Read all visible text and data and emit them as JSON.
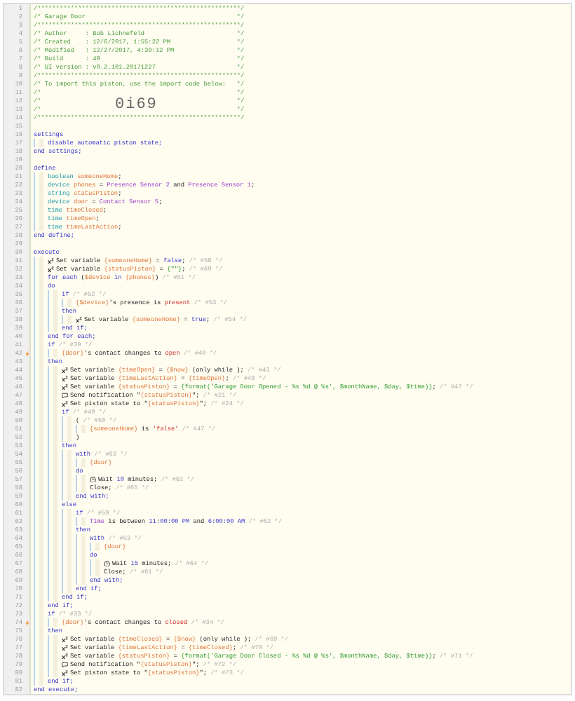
{
  "lines": [
    {
      "n": "1",
      "banner": true,
      "tokens": [
        {
          "t": "/*******************************************************/",
          "kind": "hdr"
        }
      ]
    },
    {
      "n": "2",
      "banner": true,
      "tokens": [
        {
          "t": "/* Garage Door",
          "kind": "hdr"
        },
        {
          "t": "*/",
          "kind": "hdr"
        }
      ]
    },
    {
      "n": "3",
      "banner": true,
      "tokens": [
        {
          "t": "/*******************************************************/",
          "kind": "hdr"
        }
      ]
    },
    {
      "n": "4",
      "banner": true,
      "tokens": [
        {
          "t": "/* Author     : Bob Lichnefeld",
          "kind": "hdr"
        },
        {
          "t": "*/",
          "kind": "hdr"
        }
      ]
    },
    {
      "n": "5",
      "banner": true,
      "tokens": [
        {
          "t": "/* Created    : 12/6/2017, 1:55:22 PM",
          "kind": "hdr"
        },
        {
          "t": "*/",
          "kind": "hdr"
        }
      ]
    },
    {
      "n": "6",
      "banner": true,
      "tokens": [
        {
          "t": "/* Modified   : 12/27/2017, 4:39:12 PM",
          "kind": "hdr"
        },
        {
          "t": "*/",
          "kind": "hdr"
        }
      ]
    },
    {
      "n": "7",
      "banner": true,
      "tokens": [
        {
          "t": "/* Build      : 49",
          "kind": "hdr"
        },
        {
          "t": "*/",
          "kind": "hdr"
        }
      ]
    },
    {
      "n": "8",
      "banner": true,
      "tokens": [
        {
          "t": "/* UI version : v0.2.101.20171227",
          "kind": "hdr"
        },
        {
          "t": "*/",
          "kind": "hdr"
        }
      ]
    },
    {
      "n": "9",
      "banner": true,
      "tokens": [
        {
          "t": "/*******************************************************/",
          "kind": "hdr"
        }
      ]
    },
    {
      "n": "10",
      "banner": true,
      "tokens": [
        {
          "t": "/* To import this piston, use the import code below:",
          "kind": "hdr"
        },
        {
          "t": "*/",
          "kind": "hdr"
        }
      ]
    },
    {
      "n": "11",
      "banner": true,
      "tokens": [
        {
          "t": "/*",
          "kind": "hdr"
        },
        {
          "t": "*/",
          "kind": "hdr"
        }
      ]
    },
    {
      "n": "12",
      "banner": true,
      "import_code": "0i69",
      "tokens": [
        {
          "t": "/*",
          "kind": "hdr"
        },
        {
          "t": "*/",
          "kind": "hdr"
        }
      ]
    },
    {
      "n": "13",
      "banner": true,
      "tokens": [
        {
          "t": "/*",
          "kind": "hdr"
        },
        {
          "t": "*/",
          "kind": "hdr"
        }
      ]
    },
    {
      "n": "14",
      "banner": true,
      "tokens": [
        {
          "t": "/*******************************************************/",
          "kind": "hdr"
        }
      ]
    },
    {
      "n": "15"
    },
    {
      "n": "16",
      "tokens": [
        {
          "t": "settings",
          "kind": "kw"
        }
      ],
      "children": [
        {
          "n": "17",
          "tokens": [
            {
              "t": "disable automatic piston state;",
              "kind": "kw"
            }
          ]
        }
      ]
    },
    {
      "n": "18",
      "tokens": [
        {
          "t": "end settings;",
          "kind": "kw"
        }
      ]
    },
    {
      "n": "19"
    },
    {
      "n": "20",
      "tokens": [
        {
          "t": "define",
          "kind": "kw"
        }
      ],
      "children": [
        {
          "n": "21",
          "tokens": [
            {
              "t": "boolean ",
              "kind": "type"
            },
            {
              "t": "someoneHome",
              "kind": "var"
            },
            {
              "t": ";",
              "kind": "txt"
            }
          ]
        },
        {
          "n": "22",
          "tokens": [
            {
              "t": "device ",
              "kind": "type"
            },
            {
              "t": "phones",
              "kind": "var"
            },
            {
              "t": " = ",
              "kind": "txt"
            },
            {
              "t": "Presence Sensor 2",
              "kind": "dev"
            },
            {
              "t": " and ",
              "kind": "txt"
            },
            {
              "t": "Presence Sensor 1",
              "kind": "dev"
            },
            {
              "t": ";",
              "kind": "txt"
            }
          ]
        },
        {
          "n": "23",
          "tokens": [
            {
              "t": "string ",
              "kind": "type"
            },
            {
              "t": "statusPiston",
              "kind": "var"
            },
            {
              "t": ";",
              "kind": "txt"
            }
          ]
        },
        {
          "n": "24",
          "tokens": [
            {
              "t": "device ",
              "kind": "type"
            },
            {
              "t": "door",
              "kind": "var"
            },
            {
              "t": " = ",
              "kind": "txt"
            },
            {
              "t": "Contact Sensor 5",
              "kind": "dev"
            },
            {
              "t": ";",
              "kind": "txt"
            }
          ]
        },
        {
          "n": "25",
          "tokens": [
            {
              "t": "time ",
              "kind": "type"
            },
            {
              "t": "timeClosed",
              "kind": "var"
            },
            {
              "t": ";",
              "kind": "txt"
            }
          ]
        },
        {
          "n": "26",
          "tokens": [
            {
              "t": "time ",
              "kind": "type"
            },
            {
              "t": "timeOpen",
              "kind": "var"
            },
            {
              "t": ";",
              "kind": "txt"
            }
          ]
        },
        {
          "n": "27",
          "tokens": [
            {
              "t": "time ",
              "kind": "type"
            },
            {
              "t": "timeLastAction",
              "kind": "var"
            },
            {
              "t": ";",
              "kind": "txt"
            }
          ]
        }
      ]
    },
    {
      "n": "28",
      "tokens": [
        {
          "t": "end define;",
          "kind": "kw"
        }
      ]
    },
    {
      "n": "29"
    },
    {
      "n": "30",
      "tokens": [
        {
          "t": "execute",
          "kind": "kw"
        }
      ],
      "children": [
        {
          "n": "31",
          "kind": "set",
          "tokens": [
            {
              "t": "Set variable ",
              "kind": "txt"
            },
            {
              "t": "{someoneHome}",
              "kind": "var"
            },
            {
              "t": " = ",
              "kind": "txt"
            },
            {
              "t": "false",
              "kind": "kw"
            },
            {
              "t": "; ",
              "kind": "txt"
            },
            {
              "t": "/* #58 */",
              "kind": "cmt"
            }
          ]
        },
        {
          "n": "32",
          "kind": "set",
          "tokens": [
            {
              "t": "Set variable ",
              "kind": "txt"
            },
            {
              "t": "{statusPiston}",
              "kind": "var"
            },
            {
              "t": " = ",
              "kind": "txt"
            },
            {
              "t": "{\"\"}",
              "kind": "str"
            },
            {
              "t": "; ",
              "kind": "txt"
            },
            {
              "t": "/* #60 */",
              "kind": "cmt"
            }
          ]
        },
        {
          "n": "33",
          "tokens": [
            {
              "t": "for each ",
              "kind": "kw"
            },
            {
              "t": "(",
              "kind": "txt"
            },
            {
              "t": "$device",
              "kind": "var"
            },
            {
              "t": " in ",
              "kind": "kw"
            },
            {
              "t": "{phones}",
              "kind": "var"
            },
            {
              "t": ") ",
              "kind": "txt"
            },
            {
              "t": "/* #51 */",
              "kind": "cmt"
            }
          ]
        },
        {
          "n": "34",
          "tokens": [
            {
              "t": "do",
              "kind": "kw"
            }
          ],
          "children": [
            {
              "n": "35",
              "tokens": [
                {
                  "t": "if ",
                  "kind": "kw"
                },
                {
                  "t": "/* #52 */",
                  "kind": "cmt"
                }
              ],
              "children": [
                {
                  "n": "36",
                  "tokens": [
                    {
                      "t": "{$device}",
                      "kind": "var"
                    },
                    {
                      "t": "'s presence is ",
                      "kind": "txt"
                    },
                    {
                      "t": "present",
                      "kind": "lit"
                    },
                    {
                      "t": " /* #53 */",
                      "kind": "cmt"
                    }
                  ]
                }
              ]
            },
            {
              "n": "37",
              "tokens": [
                {
                  "t": "then",
                  "kind": "kw"
                }
              ],
              "children": [
                {
                  "n": "38",
                  "kind": "set",
                  "tokens": [
                    {
                      "t": "Set variable ",
                      "kind": "txt"
                    },
                    {
                      "t": "{someoneHome}",
                      "kind": "var"
                    },
                    {
                      "t": " = ",
                      "kind": "txt"
                    },
                    {
                      "t": "true",
                      "kind": "kw"
                    },
                    {
                      "t": "; ",
                      "kind": "txt"
                    },
                    {
                      "t": "/* #54 */",
                      "kind": "cmt"
                    }
                  ]
                }
              ]
            },
            {
              "n": "39",
              "tokens": [
                {
                  "t": "end if;",
                  "kind": "kw"
                }
              ]
            }
          ]
        },
        {
          "n": "40",
          "tokens": [
            {
              "t": "end for each;",
              "kind": "kw"
            }
          ]
        },
        {
          "n": "41",
          "tokens": [
            {
              "t": "if ",
              "kind": "kw"
            },
            {
              "t": "/* #39 */",
              "kind": "cmt"
            }
          ],
          "children": [
            {
              "n": "42",
              "trigger": true,
              "tokens": [
                {
                  "t": "{door}",
                  "kind": "var"
                },
                {
                  "t": "'s contact changes to ",
                  "kind": "txt"
                },
                {
                  "t": "open",
                  "kind": "lit"
                },
                {
                  "t": " /* #40 */",
                  "kind": "cmt"
                }
              ]
            }
          ]
        },
        {
          "n": "43",
          "tokens": [
            {
              "t": "then",
              "kind": "kw"
            }
          ],
          "children": [
            {
              "n": "44",
              "kind": "set",
              "tokens": [
                {
                  "t": "Set variable ",
                  "kind": "txt"
                },
                {
                  "t": "{timeOpen}",
                  "kind": "var"
                },
                {
                  "t": " = ",
                  "kind": "txt"
                },
                {
                  "t": "{$now}",
                  "kind": "var"
                },
                {
                  "t": " (only while ); ",
                  "kind": "txt"
                },
                {
                  "t": "/* #43 */",
                  "kind": "cmt"
                }
              ]
            },
            {
              "n": "45",
              "kind": "set",
              "tokens": [
                {
                  "t": "Set variable ",
                  "kind": "txt"
                },
                {
                  "t": "{timeLastAction}",
                  "kind": "var"
                },
                {
                  "t": " = ",
                  "kind": "txt"
                },
                {
                  "t": "{timeOpen}",
                  "kind": "var"
                },
                {
                  "t": "; ",
                  "kind": "txt"
                },
                {
                  "t": "/* #48 */",
                  "kind": "cmt"
                }
              ]
            },
            {
              "n": "46",
              "kind": "set",
              "tokens": [
                {
                  "t": "Set variable ",
                  "kind": "txt"
                },
                {
                  "t": "{statusPiston}",
                  "kind": "var"
                },
                {
                  "t": " = ",
                  "kind": "txt"
                },
                {
                  "t": "{format('Garage Door Opened - %s %d @ %s', $monthName, $day, $time)}",
                  "kind": "str"
                },
                {
                  "t": "; ",
                  "kind": "txt"
                },
                {
                  "t": "/* #47 */",
                  "kind": "cmt"
                }
              ]
            },
            {
              "n": "47",
              "kind": "notify",
              "tokens": [
                {
                  "t": "Send notification \"",
                  "kind": "txt"
                },
                {
                  "t": "{statusPiston}",
                  "kind": "var"
                },
                {
                  "t": "\"; ",
                  "kind": "txt"
                },
                {
                  "t": "/* #21 */",
                  "kind": "cmt"
                }
              ]
            },
            {
              "n": "48",
              "kind": "set",
              "tokens": [
                {
                  "t": "Set piston state to \"",
                  "kind": "txt"
                },
                {
                  "t": "{statusPiston}",
                  "kind": "var"
                },
                {
                  "t": "\"; ",
                  "kind": "txt"
                },
                {
                  "t": "/* #24 */",
                  "kind": "cmt"
                }
              ]
            },
            {
              "n": "49",
              "tokens": [
                {
                  "t": "if ",
                  "kind": "kw"
                },
                {
                  "t": "/* #49 */",
                  "kind": "cmt"
                }
              ],
              "children": [
                {
                  "n": "50",
                  "tokens": [
                    {
                      "t": "( ",
                      "kind": "txt"
                    },
                    {
                      "t": "/* #50 */",
                      "kind": "cmt"
                    }
                  ],
                  "children": [
                    {
                      "n": "51",
                      "tokens": [
                        {
                          "t": "{someoneHome}",
                          "kind": "var"
                        },
                        {
                          "t": " is ",
                          "kind": "txt"
                        },
                        {
                          "t": "'false'",
                          "kind": "lit"
                        },
                        {
                          "t": " /* #47 */",
                          "kind": "cmt"
                        }
                      ]
                    }
                  ]
                },
                {
                  "n": "52",
                  "tokens": [
                    {
                      "t": ")",
                      "kind": "txt"
                    }
                  ]
                }
              ]
            },
            {
              "n": "53",
              "tokens": [
                {
                  "t": "then",
                  "kind": "kw"
                }
              ],
              "children": [
                {
                  "n": "54",
                  "tokens": [
                    {
                      "t": "with ",
                      "kind": "kw"
                    },
                    {
                      "t": "/* #63 */",
                      "kind": "cmt"
                    }
                  ],
                  "children": [
                    {
                      "n": "55",
                      "tokens": [
                        {
                          "t": "{door}",
                          "kind": "var"
                        }
                      ]
                    }
                  ]
                },
                {
                  "n": "56",
                  "tokens": [
                    {
                      "t": "do",
                      "kind": "kw"
                    }
                  ],
                  "children": [
                    {
                      "n": "57",
                      "kind": "wait",
                      "tokens": [
                        {
                          "t": "Wait ",
                          "kind": "txt"
                        },
                        {
                          "t": "10",
                          "kind": "num"
                        },
                        {
                          "t": " minutes; ",
                          "kind": "txt"
                        },
                        {
                          "t": "/* #62 */",
                          "kind": "cmt"
                        }
                      ]
                    },
                    {
                      "n": "58",
                      "tokens": [
                        {
                          "t": "Close; ",
                          "kind": "txt"
                        },
                        {
                          "t": "/* #65 */",
                          "kind": "cmt"
                        }
                      ]
                    }
                  ]
                },
                {
                  "n": "59",
                  "tokens": [
                    {
                      "t": "end with;",
                      "kind": "kw"
                    }
                  ]
                }
              ]
            },
            {
              "n": "60",
              "tokens": [
                {
                  "t": "else",
                  "kind": "kw"
                }
              ],
              "children": [
                {
                  "n": "61",
                  "tokens": [
                    {
                      "t": "if ",
                      "kind": "kw"
                    },
                    {
                      "t": "/* #59 */",
                      "kind": "cmt"
                    }
                  ],
                  "children": [
                    {
                      "n": "62",
                      "tokens": [
                        {
                          "t": "Time",
                          "kind": "dev"
                        },
                        {
                          "t": " is between ",
                          "kind": "txt"
                        },
                        {
                          "t": "11:00:00 PM",
                          "kind": "num"
                        },
                        {
                          "t": " and ",
                          "kind": "txt"
                        },
                        {
                          "t": "6:00:00 AM",
                          "kind": "num"
                        },
                        {
                          "t": " /* #62 */",
                          "kind": "cmt"
                        }
                      ]
                    }
                  ]
                },
                {
                  "n": "63",
                  "tokens": [
                    {
                      "t": "then",
                      "kind": "kw"
                    }
                  ],
                  "children": [
                    {
                      "n": "64",
                      "tokens": [
                        {
                          "t": "with ",
                          "kind": "kw"
                        },
                        {
                          "t": "/* #63 */",
                          "kind": "cmt"
                        }
                      ],
                      "children": [
                        {
                          "n": "65",
                          "tokens": [
                            {
                              "t": "{door}",
                              "kind": "var"
                            }
                          ]
                        }
                      ]
                    },
                    {
                      "n": "66",
                      "tokens": [
                        {
                          "t": "do",
                          "kind": "kw"
                        }
                      ],
                      "children": [
                        {
                          "n": "67",
                          "kind": "wait",
                          "tokens": [
                            {
                              "t": "Wait ",
                              "kind": "txt"
                            },
                            {
                              "t": "15",
                              "kind": "num"
                            },
                            {
                              "t": " minutes; ",
                              "kind": "txt"
                            },
                            {
                              "t": "/* #64 */",
                              "kind": "cmt"
                            }
                          ]
                        },
                        {
                          "n": "68",
                          "tokens": [
                            {
                              "t": "Close; ",
                              "kind": "txt"
                            },
                            {
                              "t": "/* #61 */",
                              "kind": "cmt"
                            }
                          ]
                        }
                      ]
                    },
                    {
                      "n": "69",
                      "tokens": [
                        {
                          "t": "end with;",
                          "kind": "kw"
                        }
                      ]
                    }
                  ]
                },
                {
                  "n": "70",
                  "tokens": [
                    {
                      "t": "end if;",
                      "kind": "kw"
                    }
                  ]
                }
              ]
            },
            {
              "n": "71",
              "tokens": [
                {
                  "t": "end if;",
                  "kind": "kw"
                }
              ]
            }
          ]
        },
        {
          "n": "72",
          "tokens": [
            {
              "t": "end if;",
              "kind": "kw"
            }
          ]
        },
        {
          "n": "73",
          "tokens": [
            {
              "t": "if ",
              "kind": "kw"
            },
            {
              "t": "/* #33 */",
              "kind": "cmt"
            }
          ],
          "children": [
            {
              "n": "74",
              "trigger": true,
              "tokens": [
                {
                  "t": "{door}",
                  "kind": "var"
                },
                {
                  "t": "'s contact changes to ",
                  "kind": "txt"
                },
                {
                  "t": "closed",
                  "kind": "lit"
                },
                {
                  "t": " /* #34 */",
                  "kind": "cmt"
                }
              ]
            }
          ]
        },
        {
          "n": "75",
          "tokens": [
            {
              "t": "then",
              "kind": "kw"
            }
          ],
          "children": [
            {
              "n": "76",
              "kind": "set",
              "tokens": [
                {
                  "t": "Set variable ",
                  "kind": "txt"
                },
                {
                  "t": "{timeClosed}",
                  "kind": "var"
                },
                {
                  "t": " = ",
                  "kind": "txt"
                },
                {
                  "t": "{$now}",
                  "kind": "var"
                },
                {
                  "t": " (only while ); ",
                  "kind": "txt"
                },
                {
                  "t": "/* #69 */",
                  "kind": "cmt"
                }
              ]
            },
            {
              "n": "77",
              "kind": "set",
              "tokens": [
                {
                  "t": "Set variable ",
                  "kind": "txt"
                },
                {
                  "t": "{timeLastAction}",
                  "kind": "var"
                },
                {
                  "t": " = ",
                  "kind": "txt"
                },
                {
                  "t": "{timeClosed}",
                  "kind": "var"
                },
                {
                  "t": "; ",
                  "kind": "txt"
                },
                {
                  "t": "/* #70 */",
                  "kind": "cmt"
                }
              ]
            },
            {
              "n": "78",
              "kind": "set",
              "tokens": [
                {
                  "t": "Set variable ",
                  "kind": "txt"
                },
                {
                  "t": "{statusPiston}",
                  "kind": "var"
                },
                {
                  "t": " = ",
                  "kind": "txt"
                },
                {
                  "t": "{format('Garage Door Closed - %s %d @ %s', $monthName, $day, $time)}",
                  "kind": "str"
                },
                {
                  "t": "; ",
                  "kind": "txt"
                },
                {
                  "t": "/* #71 */",
                  "kind": "cmt"
                }
              ]
            },
            {
              "n": "79",
              "kind": "notify",
              "tokens": [
                {
                  "t": "Send notification \"",
                  "kind": "txt"
                },
                {
                  "t": "{statusPiston}",
                  "kind": "var"
                },
                {
                  "t": "\"; ",
                  "kind": "txt"
                },
                {
                  "t": "/* #72 */",
                  "kind": "cmt"
                }
              ]
            },
            {
              "n": "80",
              "kind": "set",
              "tokens": [
                {
                  "t": "Set piston state to \"",
                  "kind": "txt"
                },
                {
                  "t": "{statusPiston}",
                  "kind": "var"
                },
                {
                  "t": "\"; ",
                  "kind": "txt"
                },
                {
                  "t": "/* #73 */",
                  "kind": "cmt"
                }
              ]
            }
          ]
        },
        {
          "n": "81",
          "tokens": [
            {
              "t": "end if;",
              "kind": "kw"
            }
          ]
        }
      ]
    },
    {
      "n": "82",
      "tokens": [
        {
          "t": "end execute;",
          "kind": "kw"
        }
      ]
    }
  ]
}
